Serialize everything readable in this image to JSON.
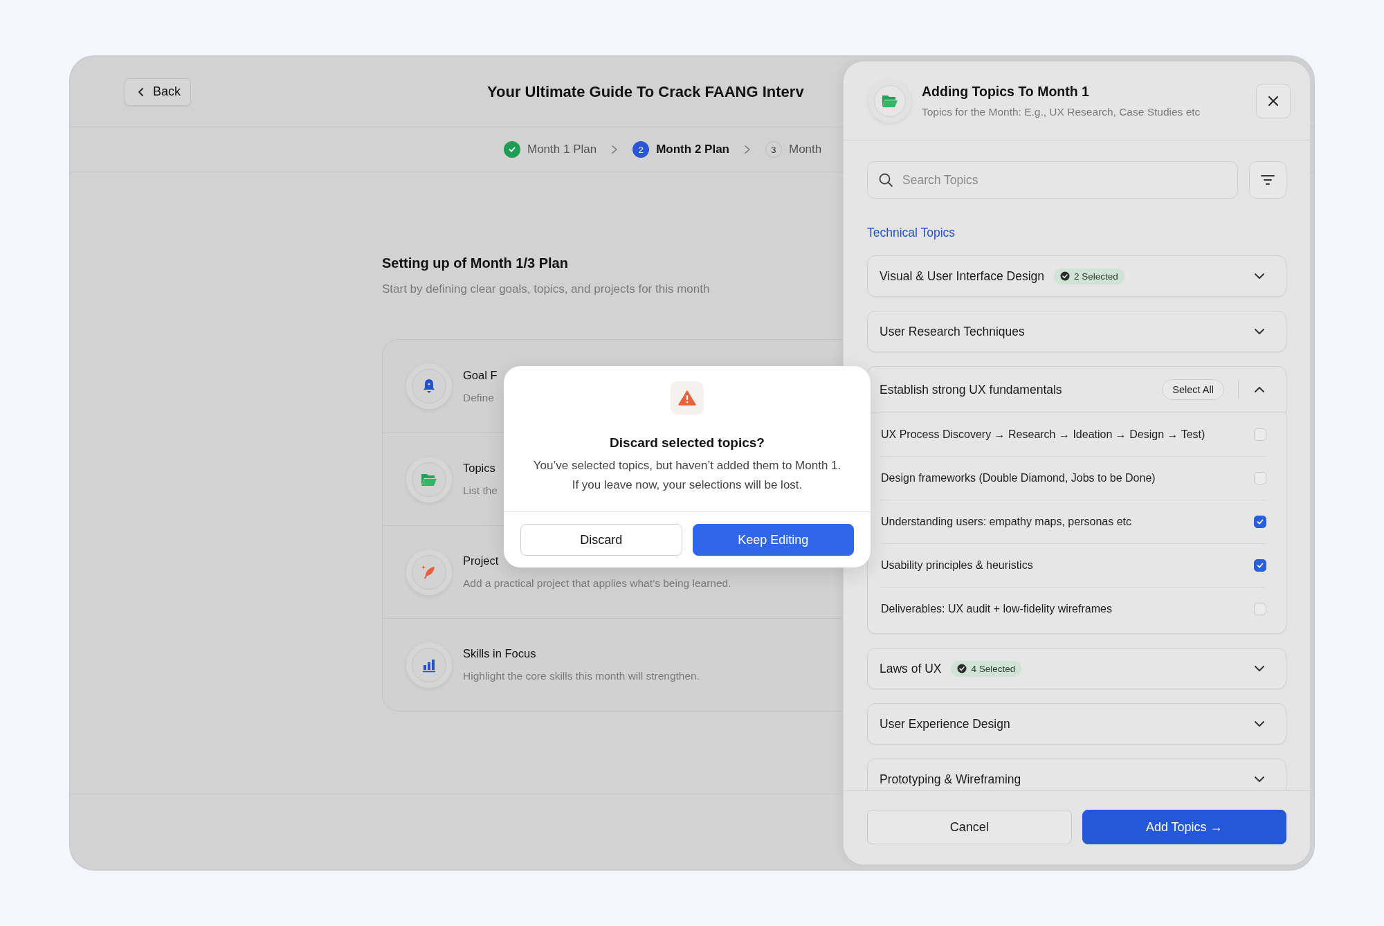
{
  "header": {
    "back_button": "Back",
    "title": "Your Ultimate Guide To Crack FAANG Interv"
  },
  "stepper": [
    {
      "label": "Month 1 Plan",
      "completed": true,
      "selected": false
    },
    {
      "number": "2",
      "label": "Month 2 Plan",
      "completed": false,
      "selected": true
    },
    {
      "number": "3",
      "label": "Month",
      "completed": false,
      "selected": false
    }
  ],
  "plan": {
    "title": "Setting up of Month 1/3 Plan",
    "subtitle": "Start by defining clear goals, topics, and projects for this month",
    "sections": [
      {
        "title": "Goal F",
        "description": "Define"
      },
      {
        "title": "Topics",
        "description": "List the"
      },
      {
        "title": "Project",
        "description": "Add a practical project that applies what’s being learned."
      },
      {
        "title": "Skills in Focus",
        "description": "Highlight the core skills this month will strengthen."
      }
    ]
  },
  "drawer": {
    "title": "Adding Topics To Month 1",
    "subtitle": "Topics for the Month: E.g., UX Research, Case Studies etc",
    "search": {
      "placeholder": "Search Topics"
    },
    "section_title": "Technical Topics",
    "groups": [
      {
        "name": "Visual & User Interface Design",
        "badge": "2 Selected",
        "expanded": false
      },
      {
        "name": "User Research Techniques",
        "expanded": false
      },
      {
        "name": "Establish strong UX fundamentals",
        "expanded": true,
        "action": "Select All",
        "items": [
          {
            "label": "UX Process Discovery → Research → Ideation → Design → Test)",
            "checked": false
          },
          {
            "label": "Design frameworks (Double Diamond, Jobs to be Done)",
            "checked": false
          },
          {
            "label": "Understanding users: empathy maps, personas etc",
            "checked": true
          },
          {
            "label": "Usability principles & heuristics",
            "checked": true
          },
          {
            "label": "Deliverables: UX audit + low-fidelity wireframes",
            "checked": false
          }
        ]
      },
      {
        "name": "Laws of UX",
        "badge": "4 Selected",
        "expanded": false
      },
      {
        "name": "User Experience Design",
        "expanded": false
      },
      {
        "name": "Prototyping & Wireframing",
        "expanded": false
      }
    ],
    "buttons": {
      "cancel": "Cancel",
      "confirm": "Add Topics →"
    }
  },
  "dialog": {
    "title": "Discard selected topics?",
    "message": "You’ve selected topics, but haven’t added them to Month 1.\nIf you leave now, your selections will be lost.",
    "buttons": {
      "secondary": "Discard",
      "primary": "Keep Editing"
    }
  }
}
